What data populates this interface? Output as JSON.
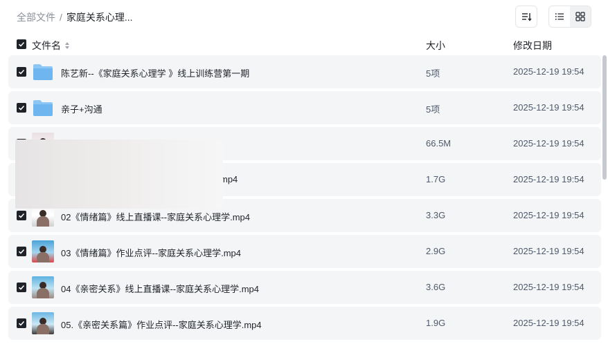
{
  "breadcrumb": {
    "root": "全部文件",
    "separator": "/",
    "current": "家庭关系心理..."
  },
  "toolbar": {
    "sort_icon": "sort-icon",
    "list_view_icon": "list-view-icon",
    "grid_view_icon": "grid-view-icon",
    "active_view": "list"
  },
  "columns": {
    "name": "文件名",
    "size": "大小",
    "date": "修改日期"
  },
  "rows": [
    {
      "type": "folder",
      "name": "陈艺新--《家庭关系心理学 》线上训练营第一期",
      "size": "5项",
      "date": "2025-12-19 19:54",
      "checked": true
    },
    {
      "type": "folder",
      "name": "亲子+沟通",
      "size": "5项",
      "date": "2025-12-19 19:54",
      "checked": true
    },
    {
      "type": "video",
      "name": "",
      "size": "66.5M",
      "date": "2025-12-19 19:54",
      "checked": true
    },
    {
      "type": "video",
      "name": "mp4",
      "size": "1.7G",
      "date": "2025-12-19 19:54",
      "checked": true
    },
    {
      "type": "video",
      "name": "02《情绪篇》线上直播课--家庭关系心理学.mp4",
      "size": "3.3G",
      "date": "2025-12-19 19:54",
      "checked": true
    },
    {
      "type": "video",
      "name": "03《情绪篇》作业点评--家庭关系心理学.mp4",
      "size": "2.9G",
      "date": "2025-12-19 19:54",
      "checked": true
    },
    {
      "type": "video",
      "name": "04《亲密关系》线上直播课--家庭关系心理学.mp4",
      "size": "3.6G",
      "date": "2025-12-19 19:54",
      "checked": true
    },
    {
      "type": "video",
      "name": "05.《亲密关系篇》作业点评--家庭关系心理学.mp4",
      "size": "1.9G",
      "date": "2025-12-19 19:54",
      "checked": true
    }
  ],
  "colors": {
    "row_bg": "#f4f5f7",
    "checkbox": "#1f2329",
    "folder": "#6fb5f0"
  }
}
